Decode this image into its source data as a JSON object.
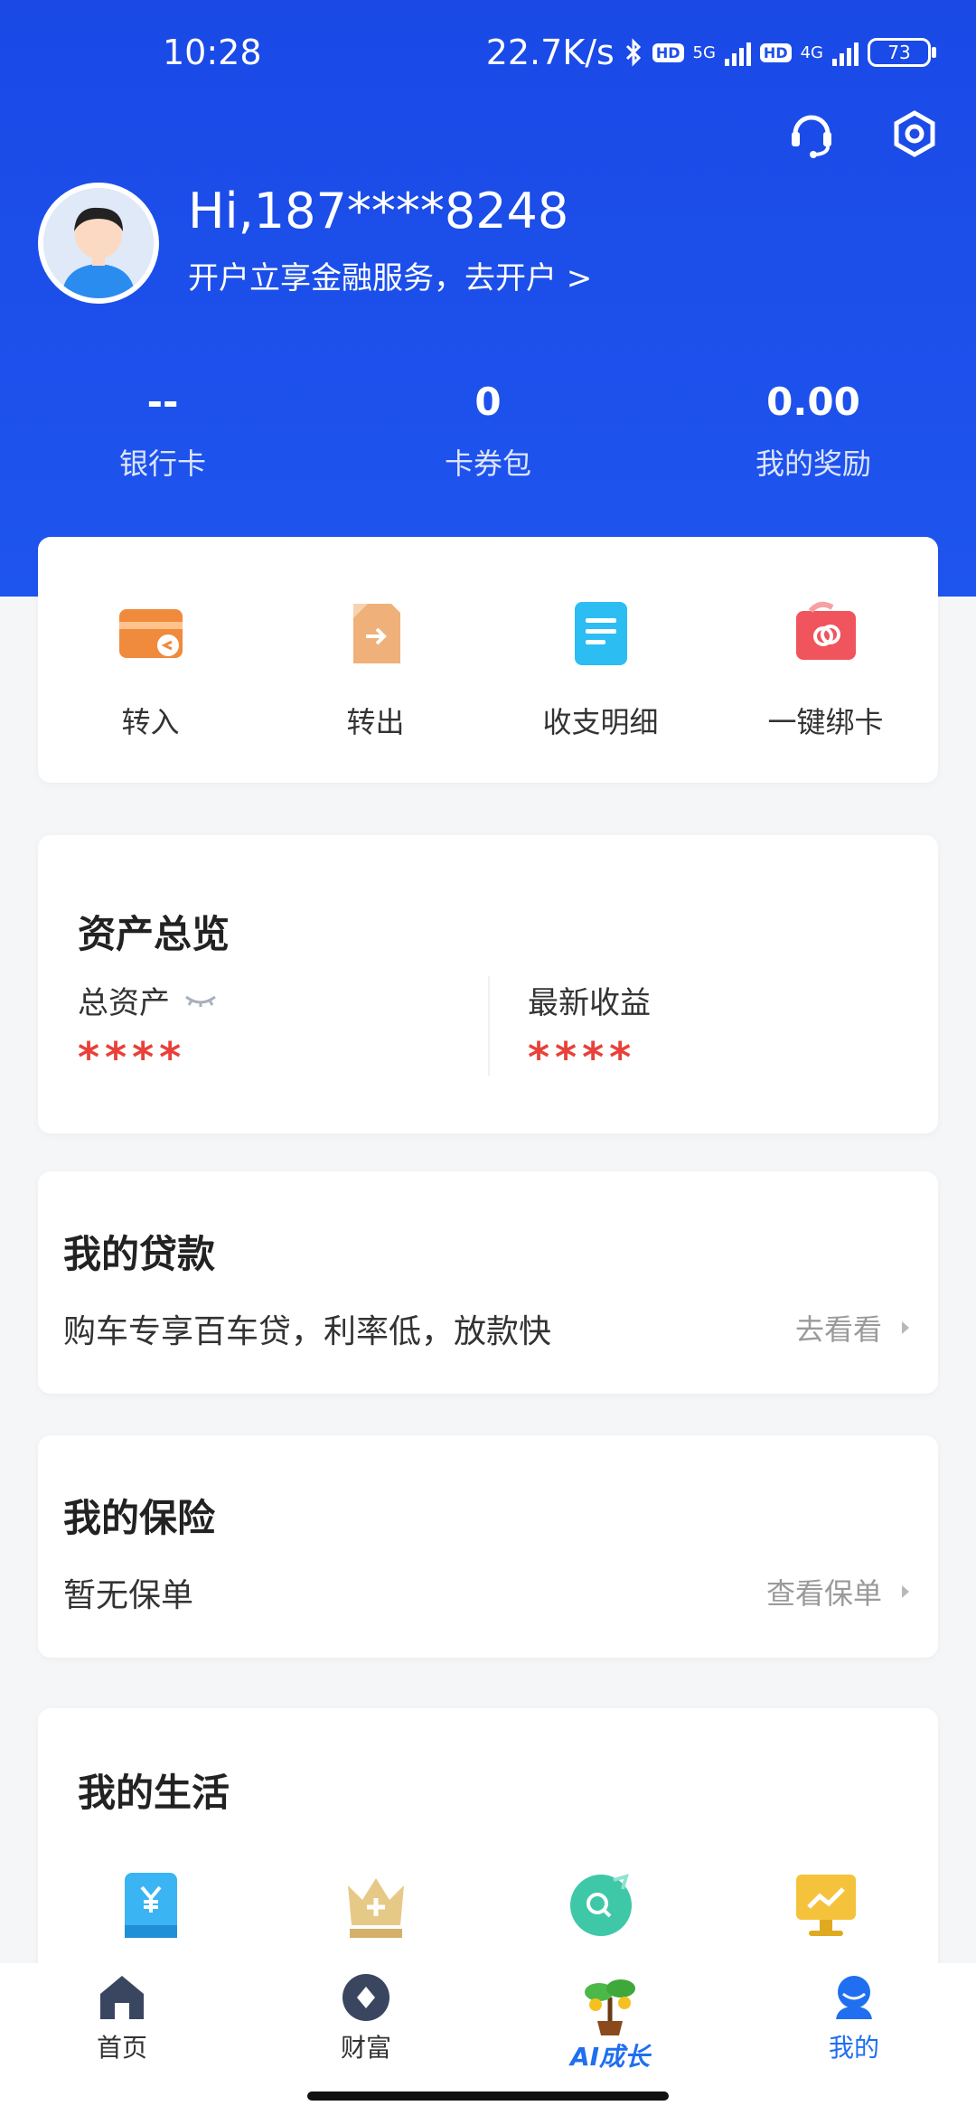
{
  "status_bar": {
    "time": "10:28",
    "speed": "22.7K/s",
    "net1": "5G",
    "net2": "4G",
    "hd": "HD",
    "battery": "73"
  },
  "header": {
    "greeting": "Hi,187****8248",
    "open_account": "开户立享金融服务，去开户 >",
    "stats": [
      {
        "value": "--",
        "label": "银行卡"
      },
      {
        "value": "0",
        "label": "卡券包"
      },
      {
        "value": "0.00",
        "label": "我的奖励"
      }
    ]
  },
  "quick_actions": [
    {
      "label": "转入",
      "color": "#f08a3c"
    },
    {
      "label": "转出",
      "color": "#efb07a"
    },
    {
      "label": "收支明细",
      "color": "#2cbdf3"
    },
    {
      "label": "一键绑卡",
      "color": "#f0545c"
    }
  ],
  "assets": {
    "title": "资产总览",
    "total_label": "总资产",
    "total_value": "****",
    "income_label": "最新收益",
    "income_value": "****"
  },
  "loan": {
    "title": "我的贷款",
    "desc": "购车专享百车贷，利率低，放款快",
    "link": "去看看"
  },
  "insurance": {
    "title": "我的保险",
    "desc": "暂无保单",
    "link": "查看保单"
  },
  "life": {
    "title": "我的生活"
  },
  "tabs": [
    {
      "label": "首页"
    },
    {
      "label": "财富"
    },
    {
      "label": "AI成长"
    },
    {
      "label": "我的"
    }
  ],
  "colors": {
    "brand": "#1f55ef",
    "masked": "#e8413a"
  }
}
